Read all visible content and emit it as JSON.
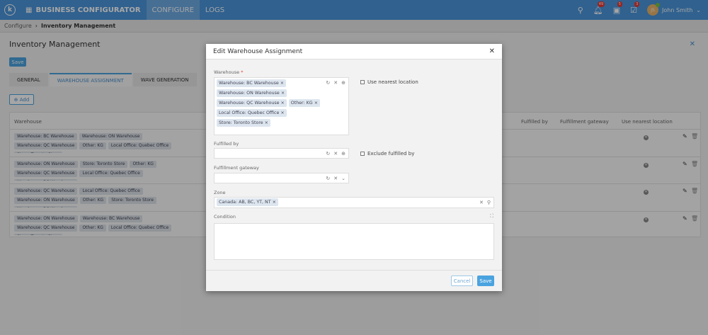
{
  "header": {
    "logo": "k",
    "app_name": "BUSINESS CONFIGURATOR",
    "nav": [
      "CONFIGURE",
      "LOGS"
    ],
    "notifications": "49",
    "tasks": "5",
    "approvals": "3",
    "user_initials": "JS",
    "user_name": "John Smith"
  },
  "breadcrumb": [
    "Configure",
    "Inventory Management"
  ],
  "page": {
    "title": "Inventory Management",
    "save_label": "Save",
    "tabs": [
      "GENERAL",
      "WAREHOUSE ASSIGNMENT",
      "WAVE GENERATION"
    ],
    "add_label": "Add"
  },
  "table": {
    "columns": [
      "Warehouse",
      "Fulfilled by",
      "Fulfillment gateway",
      "Use nearest location"
    ],
    "rows": [
      {
        "warehouses": [
          "Warehouse: BC Warehouse",
          "Warehouse: ON Warehouse",
          "Warehouse: QC Warehouse",
          "Other: KG",
          "Local Office: Quebec Office",
          "Store: Toronto Store"
        ]
      },
      {
        "warehouses": [
          "Warehouse: ON Warehouse",
          "Store: Toronto Store",
          "Other: KG",
          "Warehouse: QC Warehouse",
          "Local Office: Quebec Office",
          "Warehouse: BC Warehouse"
        ]
      },
      {
        "warehouses": [
          "Warehouse: QC Warehouse",
          "Local Office: Quebec Office",
          "Warehouse: ON Warehouse",
          "Other: KG",
          "Store: Toronto Store",
          "Warehouse: BC Warehouse"
        ]
      },
      {
        "warehouses": [
          "Warehouse: ON Warehouse",
          "Warehouse: BC Warehouse",
          "Warehouse: QC Warehouse",
          "Other: KG",
          "Local Office: Quebec Office",
          "Store: Toronto Store"
        ]
      }
    ]
  },
  "modal": {
    "title": "Edit Warehouse Assignment",
    "warehouse_label": "Warehouse",
    "required_mark": "*",
    "warehouse_values": [
      "Warehouse: BC Warehouse",
      "Warehouse: ON Warehouse",
      "Warehouse: QC Warehouse",
      "Other: KG",
      "Local Office: Quebec Office",
      "Store: Toronto Store"
    ],
    "use_nearest_label": "Use nearest location",
    "fulfilled_by_label": "Fulfilled by",
    "exclude_label": "Exclude fulfilled by",
    "gateway_label": "Fulfillment gateway",
    "zone_label": "Zone",
    "zone_values": [
      "Canada: AB, BC, YT, NT"
    ],
    "condition_label": "Condition",
    "cancel_label": "Cancel",
    "save_label": "Save"
  }
}
